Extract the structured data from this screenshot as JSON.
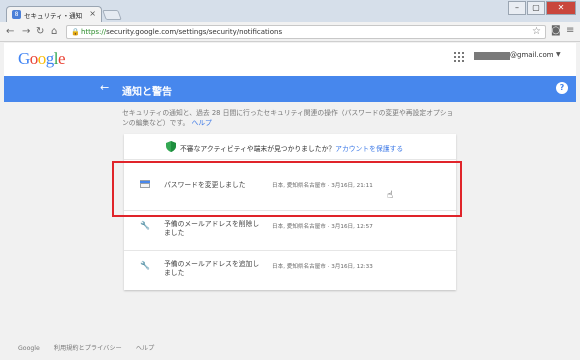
{
  "browser": {
    "tab_title": "セキュリティ・通知",
    "tab_close": "×",
    "url_scheme": "https://",
    "url_rest": "security.google.com/settings/security/notifications",
    "window_buttons": [
      "–",
      "▢",
      "✕"
    ]
  },
  "header": {
    "logo": "Google",
    "account_email_suffix": "@gmail.com"
  },
  "page": {
    "title": "通知と警告",
    "back_arrow": "←",
    "help_icon": "?",
    "description": "セキュリティの通知と、過去 28 日間に行ったセキュリティ関連の操作（パスワードの変更や再設定オプションの編集など）です。",
    "help_link": "ヘルプ"
  },
  "card": {
    "banner_text": "不審なアクティビティや端末が見つかりましたか？",
    "banner_link": "アカウントを保護する",
    "events": [
      {
        "icon": "card-icon",
        "label_line1": "パスワードを変更しました",
        "label_line2": "",
        "meta": "日本, 愛知県名古屋市 · 3月16日, 21:11"
      },
      {
        "icon": "wrench-icon",
        "label_line1": "予備のメールアドレスを削除し",
        "label_line2": "ました",
        "meta": "日本, 愛知県名古屋市 · 3月16日, 12:57"
      },
      {
        "icon": "wrench-icon",
        "label_line1": "予備のメールアドレスを追加し",
        "label_line2": "ました",
        "meta": "日本, 愛知県名古屋市 · 3月16日, 12:33"
      }
    ]
  },
  "footer": {
    "links": [
      "Google",
      "利用規約とプライバシー",
      "ヘルプ"
    ]
  },
  "colors": {
    "accent": "#4787ed",
    "highlight": "#e0242a",
    "link": "#3b78e7"
  }
}
